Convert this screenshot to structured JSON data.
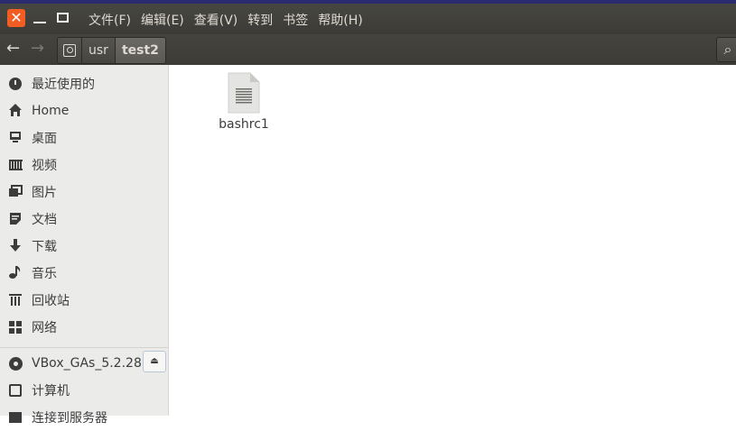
{
  "window": {
    "close_glyph": "✕"
  },
  "menubar": {
    "items": [
      "文件(F)",
      "编辑(E)",
      "查看(V)",
      "转到",
      "书签",
      "帮助(H)"
    ]
  },
  "toolbar": {
    "back_glyph": "←",
    "forward_glyph": "→",
    "breadcrumbs": [
      "usr",
      "test2"
    ],
    "search_glyph": "⌕"
  },
  "sidebar": {
    "items": [
      {
        "label": "最近使用的",
        "icon": "recent-icon"
      },
      {
        "label": "Home",
        "icon": "home-icon"
      },
      {
        "label": "桌面",
        "icon": "desktop-icon"
      },
      {
        "label": "视频",
        "icon": "video-icon"
      },
      {
        "label": "图片",
        "icon": "pictures-icon"
      },
      {
        "label": "文档",
        "icon": "documents-icon"
      },
      {
        "label": "下载",
        "icon": "download-icon"
      },
      {
        "label": "音乐",
        "icon": "music-icon"
      },
      {
        "label": "回收站",
        "icon": "trash-icon"
      },
      {
        "label": "网络",
        "icon": "network-icon"
      }
    ],
    "devices": [
      {
        "label": "VBox_GAs_5.2.28",
        "icon": "optical-disc-icon",
        "eject_glyph": "⏏"
      },
      {
        "label": "计算机",
        "icon": "computer-icon"
      },
      {
        "label": "连接到服务器",
        "icon": "server-icon"
      }
    ]
  },
  "content": {
    "files": [
      {
        "name": "bashrc1",
        "icon": "text-file-icon"
      }
    ]
  },
  "colors": {
    "menubar": "#3c3b37",
    "close_button": "#f15d22",
    "sidebar": "#ebebea",
    "content": "#ffffff"
  }
}
